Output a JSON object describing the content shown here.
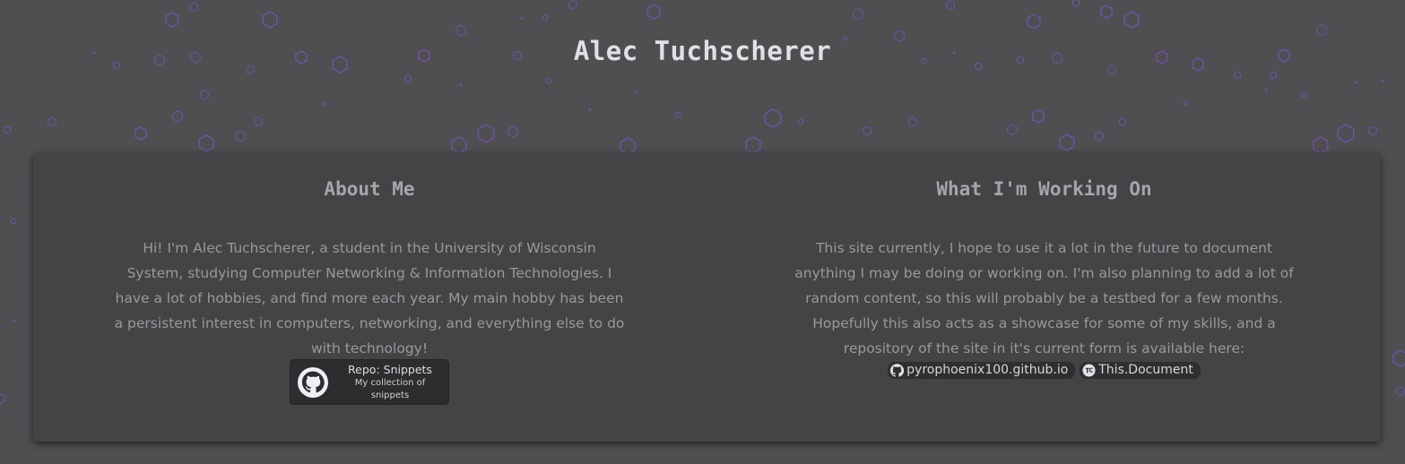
{
  "header": {
    "title": "Alec Tuchscherer"
  },
  "about": {
    "heading": "About Me",
    "body": "Hi! I'm Alec Tuchscherer, a student in the University of Wisconsin System, studying Computer Networking & Information Technologies. I have a lot of hobbies, and find more each year. My main hobby has been a persistent interest in computers, networking, and everything else to do with technology!",
    "repo": {
      "title": "Repo: Snippets",
      "subtitle": "My collection of snippets",
      "icon": "github-icon"
    }
  },
  "working": {
    "heading": "What I'm Working On",
    "body": "This site currently, I hope to use it a lot in the future to document anything I may be doing or working on. I'm also planning to add a lot of random content, so this will probably be a testbed for a few months. Hopefully this also acts as a showcase for some of my skills, and a repository of the site in it's current form is available here:",
    "links": [
      {
        "label": "pyrophoenix100.github.io",
        "icon": "github-icon"
      },
      {
        "label": "This.Document",
        "icon": "document-logo-icon"
      }
    ]
  },
  "theme": {
    "background": "#4f4e51",
    "card": "#444345",
    "hexagon_accent": "#7a55c8"
  }
}
